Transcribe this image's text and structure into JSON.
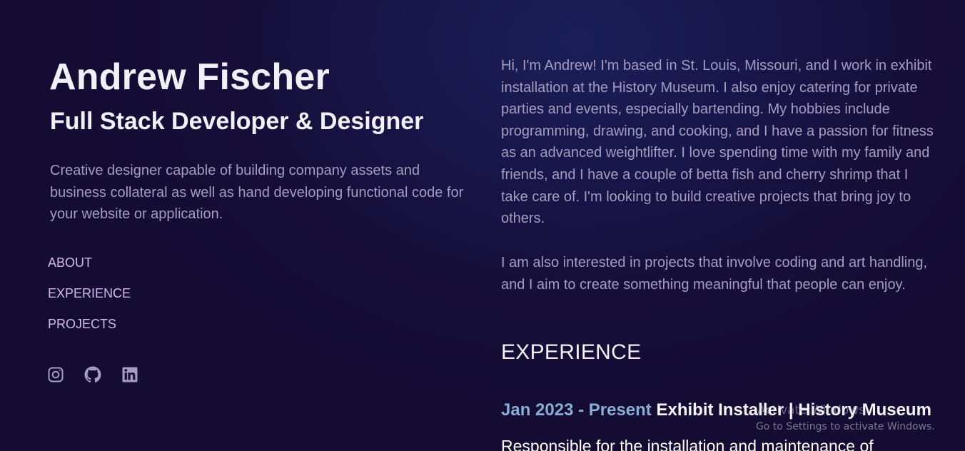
{
  "profile": {
    "name": "Andrew Fischer",
    "role": "Full Stack Developer & Designer",
    "tagline": "Creative designer capable of building company assets and business collateral as well as hand developing functional code for your website or application."
  },
  "nav": {
    "items": [
      {
        "label": "ABOUT"
      },
      {
        "label": "EXPERIENCE"
      },
      {
        "label": "PROJECTS"
      }
    ]
  },
  "socials": [
    {
      "icon": "instagram-icon"
    },
    {
      "icon": "github-icon"
    },
    {
      "icon": "linkedin-icon"
    }
  ],
  "about": {
    "paragraph1": "Hi, I'm Andrew! I'm based in St. Louis, Missouri, and I work in exhibit installation at the History Museum. I also enjoy catering for private parties and events, especially bartending. My hobbies include programming, drawing, and cooking, and I have a passion for fitness as an advanced weightlifter. I love spending time with my family and friends, and I have a couple of betta fish and cherry shrimp that I take care of. I'm looking to build creative projects that bring joy to others.",
    "paragraph2": "I am also interested in projects that involve coding and art handling, and I aim to create something meaningful that people can enjoy."
  },
  "experience": {
    "heading": "EXPERIENCE",
    "jobs": [
      {
        "dates": "Jan 2023 - Present",
        "title": "Exhibit Installer | History Museum",
        "description": "Responsible for the installation and maintenance of"
      }
    ]
  },
  "watermark": {
    "line1": "Activate Windows",
    "line2": "Go to Settings to activate Windows."
  },
  "colors": {
    "background": "#160f3a",
    "heading": "#f1f0f8",
    "body_text": "#a59cc0",
    "nav_link": "#d4b8ec",
    "date_accent": "#88aed3"
  }
}
